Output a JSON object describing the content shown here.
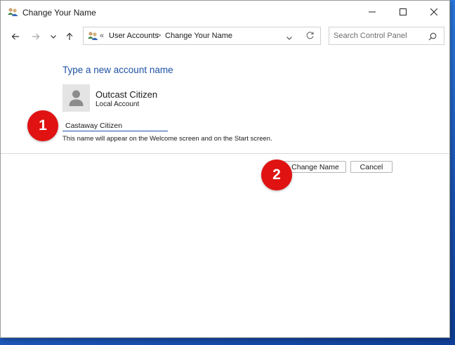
{
  "window": {
    "title": "Change Your Name"
  },
  "address_bar": {
    "overflow": "«",
    "crumbs": [
      "User Accounts",
      "Change Your Name"
    ],
    "separator": ">"
  },
  "search": {
    "placeholder": "Search Control Panel"
  },
  "content": {
    "heading": "Type a new account name",
    "account_name": "Outcast Citizen",
    "account_type": "Local Account",
    "name_value": "Castaway Citizen",
    "hint": "This name will appear on the Welcome screen and on the Start screen."
  },
  "buttons": {
    "change": "Change Name",
    "cancel": "Cancel"
  },
  "badges": [
    "1",
    "2"
  ],
  "colors": {
    "accent": "#1f52a3",
    "badge": "#e01212"
  }
}
